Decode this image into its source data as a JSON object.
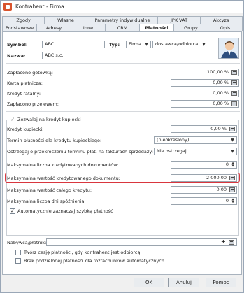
{
  "window": {
    "title": "Kontrahent - Firma"
  },
  "tabs_row1": [
    "Zgody",
    "Własne",
    "Parametry indywidualne",
    "JPK VAT",
    "Akcyza"
  ],
  "tabs_row2": [
    "Podstawowe",
    "Adresy",
    "Inne",
    "CRM",
    "Płatności",
    "Grupy",
    "Opis"
  ],
  "active_tab": "Płatności",
  "header": {
    "symbol_label": "Symbol:",
    "symbol_value": "ABC",
    "typ_label": "Typ:",
    "typ_value": "Firma",
    "typ2_value": "dostawca/odbiorca",
    "nazwa_label": "Nazwa:",
    "nazwa_value": "ABC s.c."
  },
  "payments": [
    {
      "label": "Zapłacono gotówką:",
      "value": "100,00 %"
    },
    {
      "label": "Karta płatnicza:",
      "value": "0,00 %"
    },
    {
      "label": "Kredyt ratalny:",
      "value": "0,00 %"
    },
    {
      "label": "Zapłacono przelewem:",
      "value": "0,00 %"
    }
  ],
  "credit": {
    "enable_label": "Zezwalaj na kredyt kupiecki",
    "enable_checked": true,
    "limit_label": "Kredyt kupiecki:",
    "limit_value": "0,00 %",
    "term_label": "Termin płatności dla kredytu kupieckiego:",
    "term_value": "(nieokreślony)",
    "warn_label": "Ostrzegaj o przekroczeniu terminu płat. na fakturach sprzedaży:",
    "warn_value": "Nie ostrzegaj",
    "max_docs_label": "Maksymalna liczba kredytowanych dokumentów:",
    "max_docs_value": "0",
    "max_doc_value_label": "Maksymalna wartość kredytowanego dokumentu:",
    "max_doc_value_value": "2 000,00",
    "max_total_label": "Maksymalna wartość całego kredytu:",
    "max_total_value": "0,00",
    "max_days_label": "Maksymalna liczba dni spóźnienia:",
    "max_days_value": "0",
    "auto_label": "Automatycznie zaznaczaj szybką płatność",
    "auto_checked": true
  },
  "payer": {
    "label": "Nabywca/płatnik:",
    "value": ""
  },
  "options": [
    {
      "label": "Twórz cesję płatności, gdy kontrahent jest odbiorcą",
      "checked": false
    },
    {
      "label": "Brak podzielonej płatności dla rozrachunków automatycznych",
      "checked": false
    }
  ],
  "buttons": {
    "ok": "OK",
    "cancel": "Anuluj",
    "help": "Pomoc"
  },
  "colors": {
    "highlight": "#d9363e",
    "avatar_bg": "#e3edf7"
  }
}
